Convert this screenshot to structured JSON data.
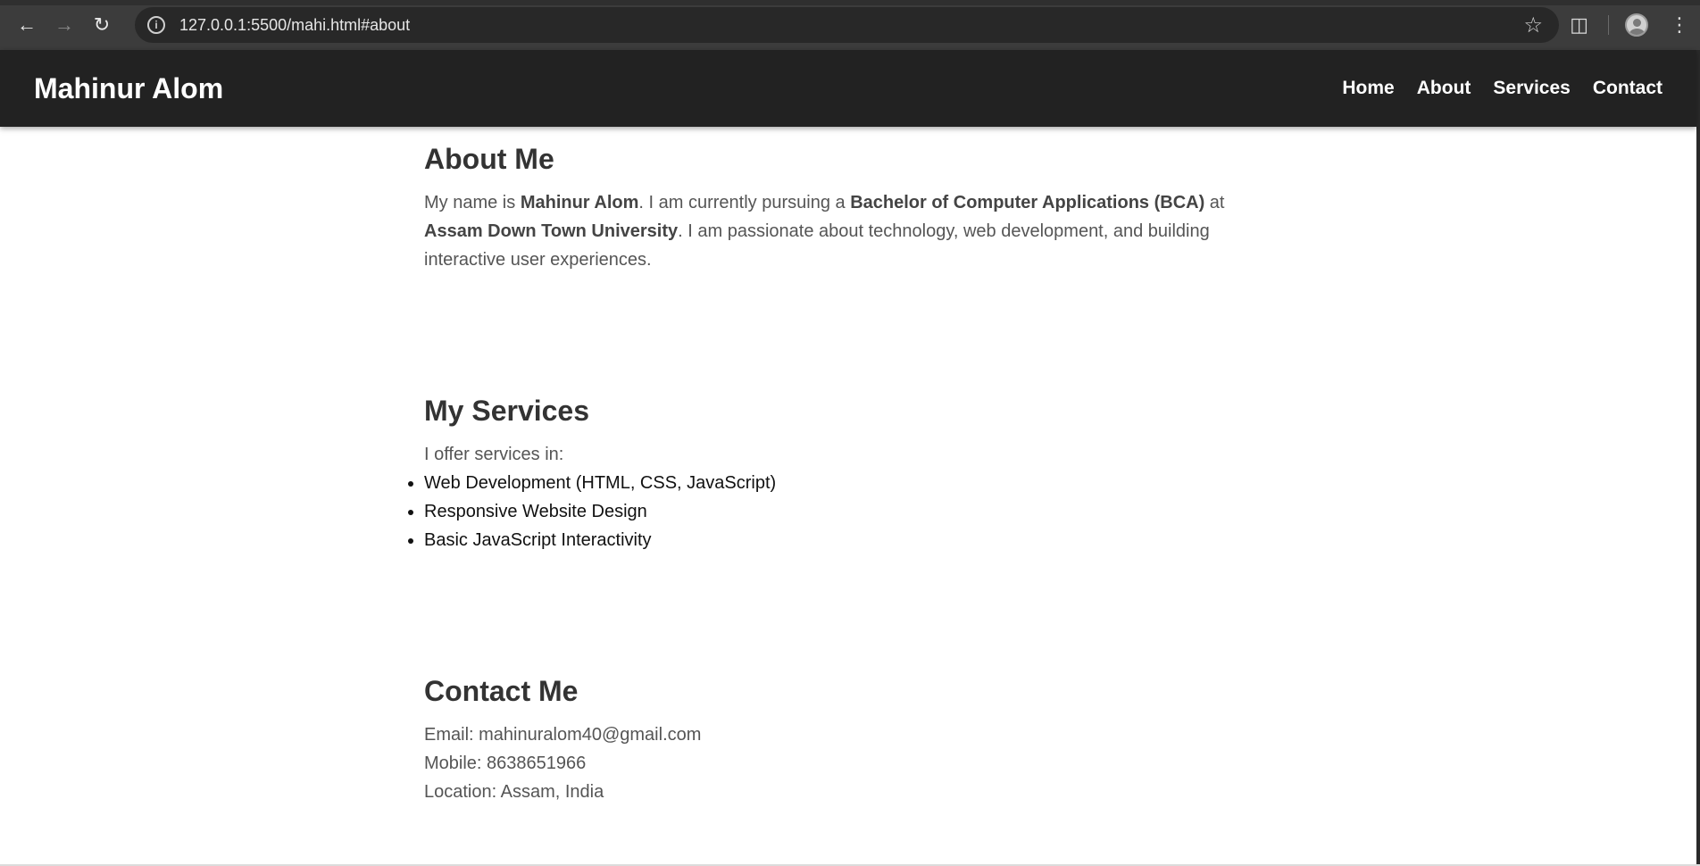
{
  "browser": {
    "url": "127.0.0.1:5500/mahi.html#about"
  },
  "header": {
    "brand": "Mahinur Alom",
    "nav": [
      {
        "label": "Home"
      },
      {
        "label": "About"
      },
      {
        "label": "Services"
      },
      {
        "label": "Contact"
      }
    ]
  },
  "about": {
    "title": "About Me",
    "text_1": "My name is ",
    "name": "Mahinur Alom",
    "text_2": ". I am currently pursuing a ",
    "degree": "Bachelor of Computer Applications (BCA)",
    "text_3": " at ",
    "university": "Assam Down Town University",
    "text_4": ". I am passionate about technology, web development, and building interactive user experiences."
  },
  "services": {
    "title": "My Services",
    "intro": "I offer services in:",
    "items": [
      "Web Development (HTML, CSS, JavaScript)",
      "Responsive Website Design",
      "Basic JavaScript Interactivity"
    ]
  },
  "contact": {
    "title": "Contact Me",
    "email": "Email: mahinuralom40@gmail.com",
    "mobile": "Mobile: 8638651966",
    "location": "Location: Assam, India"
  }
}
